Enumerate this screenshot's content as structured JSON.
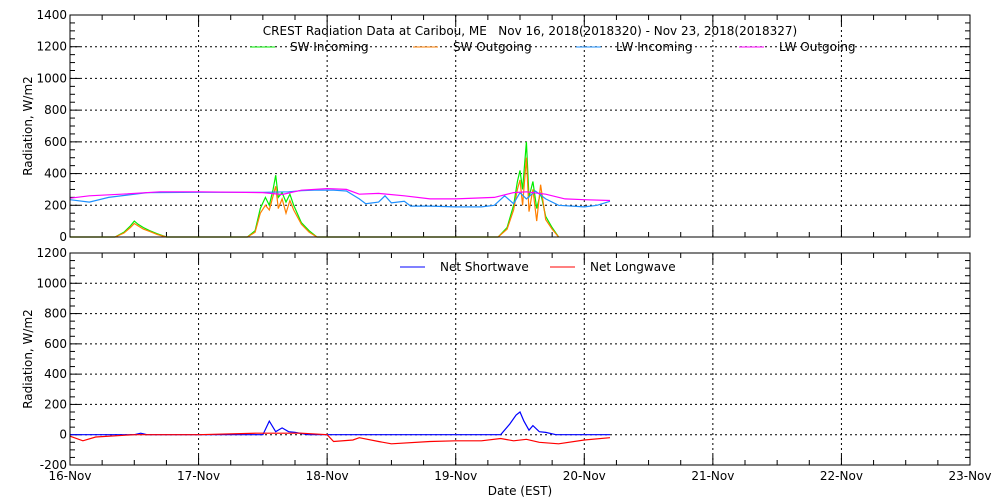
{
  "chart_data": [
    {
      "type": "line",
      "title": "CREST Radiation Data at Caribou, ME   Nov 16, 2018(2018320) - Nov 23, 2018(2018327)",
      "xlabel": "",
      "ylabel": "Radiation, W/m2",
      "ylim": [
        0,
        1400
      ],
      "yticks": [
        "0",
        "200",
        "400",
        "600",
        "800",
        "1000",
        "1200",
        "1400"
      ],
      "xlim_days": [
        0,
        7
      ],
      "grid": true,
      "legend": "top-center",
      "series": [
        {
          "name": "SW Incoming",
          "color": "#00ee00",
          "points": [
            [
              0,
              0
            ],
            [
              0.35,
              0
            ],
            [
              0.42,
              30
            ],
            [
              0.47,
              70
            ],
            [
              0.5,
              100
            ],
            [
              0.53,
              80
            ],
            [
              0.57,
              60
            ],
            [
              0.62,
              40
            ],
            [
              0.68,
              20
            ],
            [
              0.75,
              0
            ],
            [
              1.38,
              0
            ],
            [
              1.44,
              40
            ],
            [
              1.48,
              180
            ],
            [
              1.52,
              250
            ],
            [
              1.55,
              200
            ],
            [
              1.58,
              300
            ],
            [
              1.6,
              390
            ],
            [
              1.62,
              250
            ],
            [
              1.65,
              280
            ],
            [
              1.68,
              220
            ],
            [
              1.71,
              270
            ],
            [
              1.74,
              200
            ],
            [
              1.8,
              90
            ],
            [
              1.86,
              40
            ],
            [
              1.92,
              0
            ],
            [
              3.33,
              0
            ],
            [
              3.4,
              60
            ],
            [
              3.45,
              200
            ],
            [
              3.48,
              350
            ],
            [
              3.5,
              420
            ],
            [
              3.52,
              300
            ],
            [
              3.55,
              600
            ],
            [
              3.57,
              250
            ],
            [
              3.6,
              350
            ],
            [
              3.63,
              180
            ],
            [
              3.66,
              280
            ],
            [
              3.7,
              130
            ],
            [
              3.75,
              60
            ],
            [
              3.8,
              0
            ]
          ]
        },
        {
          "name": "SW Outgoing",
          "color": "#ff7f00",
          "points": [
            [
              0,
              0
            ],
            [
              0.35,
              0
            ],
            [
              0.42,
              25
            ],
            [
              0.47,
              60
            ],
            [
              0.5,
              85
            ],
            [
              0.53,
              70
            ],
            [
              0.57,
              50
            ],
            [
              0.62,
              35
            ],
            [
              0.68,
              15
            ],
            [
              0.75,
              0
            ],
            [
              1.38,
              0
            ],
            [
              1.44,
              30
            ],
            [
              1.48,
              150
            ],
            [
              1.52,
              200
            ],
            [
              1.55,
              170
            ],
            [
              1.58,
              260
            ],
            [
              1.6,
              320
            ],
            [
              1.62,
              180
            ],
            [
              1.65,
              240
            ],
            [
              1.68,
              150
            ],
            [
              1.71,
              230
            ],
            [
              1.74,
              170
            ],
            [
              1.8,
              80
            ],
            [
              1.86,
              30
            ],
            [
              1.92,
              0
            ],
            [
              3.33,
              0
            ],
            [
              3.4,
              50
            ],
            [
              3.45,
              170
            ],
            [
              3.48,
              300
            ],
            [
              3.5,
              360
            ],
            [
              3.52,
              200
            ],
            [
              3.55,
              500
            ],
            [
              3.57,
              160
            ],
            [
              3.6,
              300
            ],
            [
              3.63,
              100
            ],
            [
              3.66,
              330
            ],
            [
              3.7,
              110
            ],
            [
              3.75,
              50
            ],
            [
              3.8,
              0
            ]
          ]
        },
        {
          "name": "LW Incoming",
          "color": "#1e90ff",
          "points": [
            [
              0,
              235
            ],
            [
              0.15,
              220
            ],
            [
              0.3,
              250
            ],
            [
              0.45,
              265
            ],
            [
              0.6,
              280
            ],
            [
              1.0,
              282
            ],
            [
              1.5,
              282
            ],
            [
              1.7,
              285
            ],
            [
              1.8,
              292
            ],
            [
              1.9,
              295
            ],
            [
              2.05,
              295
            ],
            [
              2.15,
              290
            ],
            [
              2.25,
              240
            ],
            [
              2.3,
              210
            ],
            [
              2.4,
              220
            ],
            [
              2.45,
              260
            ],
            [
              2.5,
              215
            ],
            [
              2.6,
              225
            ],
            [
              2.65,
              195
            ],
            [
              2.8,
              195
            ],
            [
              3.0,
              190
            ],
            [
              3.2,
              190
            ],
            [
              3.3,
              200
            ],
            [
              3.38,
              260
            ],
            [
              3.45,
              210
            ],
            [
              3.5,
              280
            ],
            [
              3.55,
              240
            ],
            [
              3.62,
              290
            ],
            [
              3.7,
              240
            ],
            [
              3.8,
              200
            ],
            [
              4.0,
              190
            ],
            [
              4.1,
              200
            ],
            [
              4.2,
              225
            ]
          ]
        },
        {
          "name": "LW Outgoing",
          "color": "#ff00ff",
          "points": [
            [
              0,
              245
            ],
            [
              0.15,
              260
            ],
            [
              0.4,
              270
            ],
            [
              0.7,
              285
            ],
            [
              1.0,
              285
            ],
            [
              1.5,
              280
            ],
            [
              1.65,
              268
            ],
            [
              1.8,
              295
            ],
            [
              2.0,
              305
            ],
            [
              2.15,
              300
            ],
            [
              2.25,
              270
            ],
            [
              2.4,
              275
            ],
            [
              2.6,
              260
            ],
            [
              2.8,
              240
            ],
            [
              3.0,
              240
            ],
            [
              3.3,
              250
            ],
            [
              3.45,
              280
            ],
            [
              3.55,
              285
            ],
            [
              3.7,
              270
            ],
            [
              3.85,
              240
            ],
            [
              4.0,
              235
            ],
            [
              4.2,
              230
            ]
          ]
        }
      ]
    },
    {
      "type": "line",
      "xlabel": "Date (EST)",
      "ylabel": "Radiation, W/m2",
      "ylim": [
        -200,
        1200
      ],
      "yticks": [
        "-200",
        "0",
        "200",
        "400",
        "600",
        "800",
        "1000",
        "1200"
      ],
      "xticks": [
        "16-Nov",
        "17-Nov",
        "18-Nov",
        "19-Nov",
        "20-Nov",
        "21-Nov",
        "22-Nov",
        "23-Nov"
      ],
      "xlim_days": [
        0,
        7
      ],
      "grid": true,
      "legend": "top-center",
      "series": [
        {
          "name": "Net Shortwave",
          "color": "#0000ff",
          "points": [
            [
              0,
              0
            ],
            [
              0.5,
              0
            ],
            [
              0.55,
              10
            ],
            [
              0.6,
              0
            ],
            [
              1.5,
              0
            ],
            [
              1.55,
              90
            ],
            [
              1.6,
              20
            ],
            [
              1.65,
              45
            ],
            [
              1.7,
              20
            ],
            [
              1.75,
              15
            ],
            [
              1.85,
              0
            ],
            [
              3.35,
              0
            ],
            [
              3.42,
              70
            ],
            [
              3.47,
              130
            ],
            [
              3.5,
              150
            ],
            [
              3.53,
              90
            ],
            [
              3.57,
              30
            ],
            [
              3.6,
              60
            ],
            [
              3.65,
              20
            ],
            [
              3.7,
              15
            ],
            [
              3.78,
              0
            ],
            [
              4.2,
              0
            ]
          ]
        },
        {
          "name": "Net Longwave",
          "color": "#ff0000",
          "points": [
            [
              0,
              -10
            ],
            [
              0.1,
              -40
            ],
            [
              0.2,
              -15
            ],
            [
              0.5,
              0
            ],
            [
              1.0,
              0
            ],
            [
              1.45,
              10
            ],
            [
              1.8,
              10
            ],
            [
              2.0,
              0
            ],
            [
              2.05,
              -45
            ],
            [
              2.2,
              -35
            ],
            [
              2.25,
              -20
            ],
            [
              2.4,
              -45
            ],
            [
              2.5,
              -60
            ],
            [
              2.8,
              -45
            ],
            [
              3.0,
              -40
            ],
            [
              3.2,
              -40
            ],
            [
              3.35,
              -25
            ],
            [
              3.45,
              -40
            ],
            [
              3.55,
              -30
            ],
            [
              3.65,
              -50
            ],
            [
              3.8,
              -60
            ],
            [
              4.0,
              -35
            ],
            [
              4.2,
              -20
            ]
          ]
        }
      ]
    }
  ]
}
